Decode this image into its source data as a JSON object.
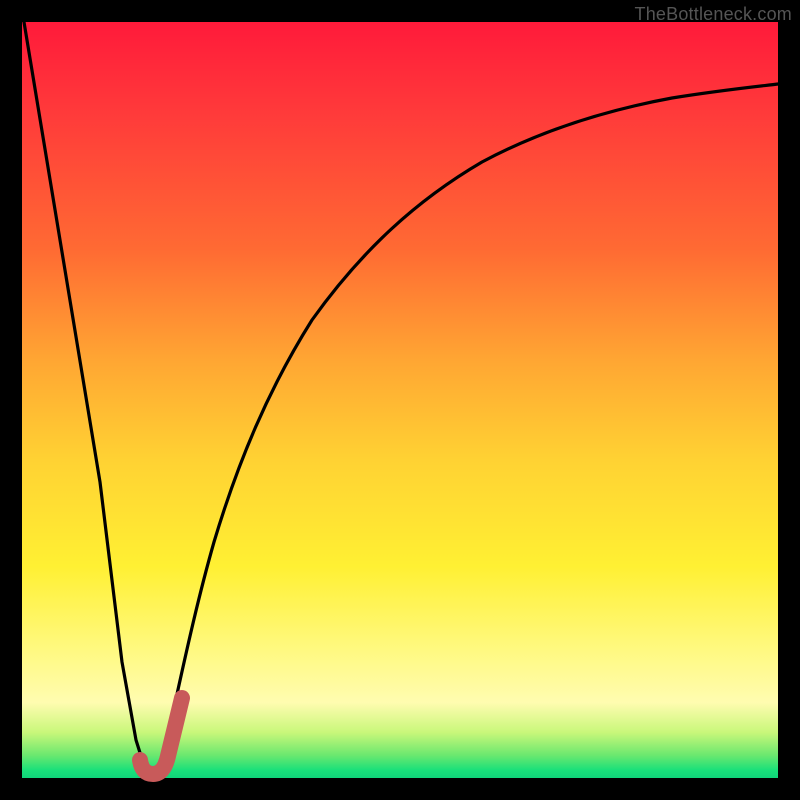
{
  "watermark": "TheBottleneck.com",
  "colors": {
    "frame": "#000000",
    "curve": "#000000",
    "marker": "#c85a5a",
    "gradient_stops": [
      "#ff1a3a",
      "#ff6a33",
      "#ffd233",
      "#fff980",
      "#18e07a"
    ]
  },
  "chart_data": {
    "type": "line",
    "title": "",
    "xlabel": "",
    "ylabel": "",
    "xlim": [
      0,
      100
    ],
    "ylim": [
      0,
      100
    ],
    "grid": false,
    "legend": false,
    "series": [
      {
        "name": "bottleneck-curve",
        "x": [
          0,
          5,
          10,
          13,
          15,
          16.5,
          18,
          20,
          22,
          25,
          28,
          32,
          38,
          45,
          55,
          65,
          75,
          85,
          95,
          100
        ],
        "y": [
          100,
          70,
          40,
          15,
          5,
          0,
          3,
          12,
          23,
          36,
          47,
          57,
          67,
          75,
          82,
          86,
          89,
          91,
          92,
          92.5
        ]
      }
    ],
    "annotations": [
      {
        "name": "selected-marker",
        "shape": "J-hook",
        "x_range": [
          16.5,
          20
        ],
        "y_range": [
          0,
          11
        ],
        "color": "#c85a5a"
      }
    ]
  }
}
